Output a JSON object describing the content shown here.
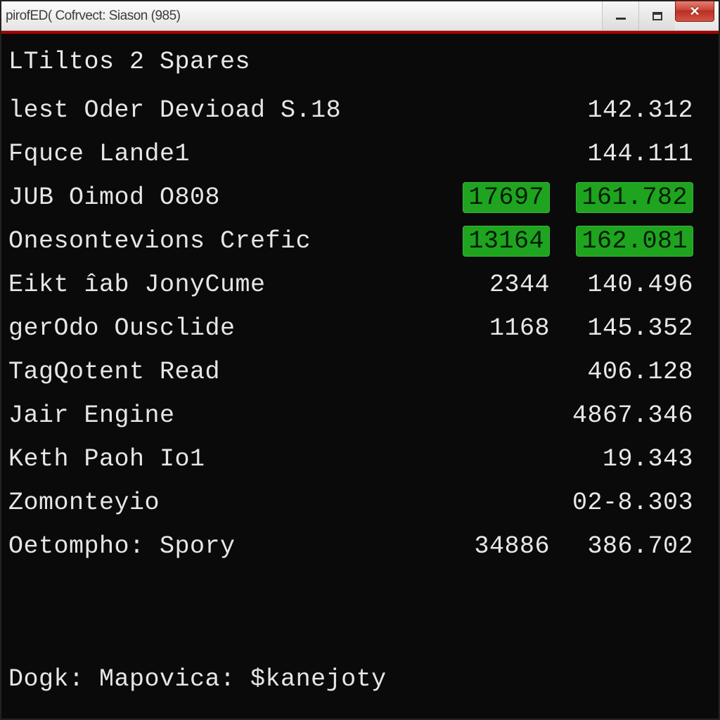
{
  "window": {
    "title": "pirofED( Cofrvect: Siason (985)"
  },
  "section_title": "LTiltos 2 Spares",
  "rows": [
    {
      "label": "lest Oder Devioad S.18",
      "a": "",
      "b": "142.312",
      "hl": false
    },
    {
      "label": "Fquce Lande1",
      "a": "",
      "b": "144.111",
      "hl": false
    },
    {
      "label": "JUB  Oimod O808",
      "a": "17697",
      "b": "161.782",
      "hl": true
    },
    {
      "label": "Onesontevions Crefic",
      "a": "13164",
      "b": "162.081",
      "hl": true
    },
    {
      "label": "Eikt îab JonyCume",
      "a": "2344",
      "b": "140.496",
      "hl": false
    },
    {
      "label": "gerOdo Ousclide",
      "a": "1168",
      "b": "145.352",
      "hl": false
    },
    {
      "label": "TagQotent Read",
      "a": "",
      "b": "406.128",
      "hl": false
    },
    {
      "label": "Jair Engine",
      "a": "",
      "b": "4867.346",
      "hl": false
    },
    {
      "label": "Keth Paoh Io1",
      "a": "",
      "b": "19.343",
      "hl": false
    },
    {
      "label": "Zomonteyio",
      "a": "",
      "b": "02-8.303",
      "hl": false
    },
    {
      "label": "Oetompho: Spory",
      "a": "34886",
      "b": "386.702",
      "hl": false
    }
  ],
  "footer": "Dogk: Mapovica: $kanejoty"
}
